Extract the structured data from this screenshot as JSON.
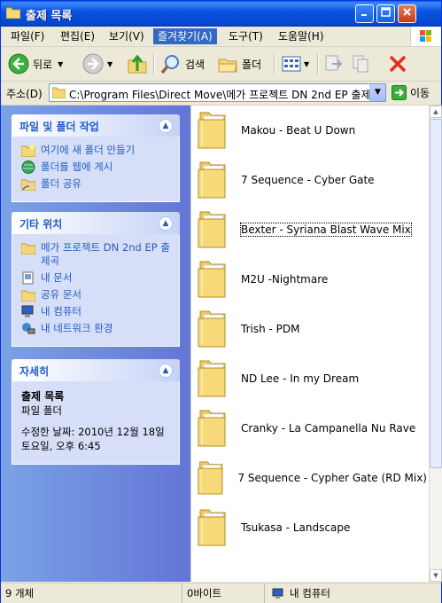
{
  "window": {
    "title": "출제 목록"
  },
  "menu": [
    "파일(F)",
    "편집(E)",
    "보기(V)",
    "즐겨찾기(A)",
    "도구(T)",
    "도움말(H)"
  ],
  "toolbar": {
    "back": "뒤로",
    "search": "검색",
    "folders": "폴더"
  },
  "address": {
    "label": "주소(D)",
    "path": "C:\\Program Files\\Direct Move\\메가 프로젝트 DN 2nd EP 출제",
    "go": "이동"
  },
  "tasks": {
    "title": "파일 및 폴더 작업",
    "items": [
      "여기에 새 폴더 만들기",
      "폴더를 웹에 게시",
      "폴더 공유"
    ]
  },
  "places": {
    "title": "기타 위치",
    "items": [
      "메가 프로젝트 DN 2nd EP 출제곡",
      "내 문서",
      "공유 문서",
      "내 컴퓨터",
      "내 네트워크 환경"
    ]
  },
  "details": {
    "title": "자세히",
    "name": "출제 목록",
    "type": "파일 폴더",
    "modified": "수정한 날짜: 2010년 12월 18일 토요일, 오후 6:45"
  },
  "folders": [
    "Makou - Beat U Down",
    "7 Sequence - Cyber Gate",
    "Bexter - Syriana Blast Wave Mix",
    "M2U -Nightmare",
    "Trish - PDM",
    "ND Lee - In my Dream",
    "Cranky - La Campanella  Nu Rave",
    "7 Sequence - Cypher Gate (RD Mix)",
    "Tsukasa - Landscape"
  ],
  "status": {
    "count": "9 개체",
    "size": "0바이트",
    "location": "내 컴퓨터"
  }
}
